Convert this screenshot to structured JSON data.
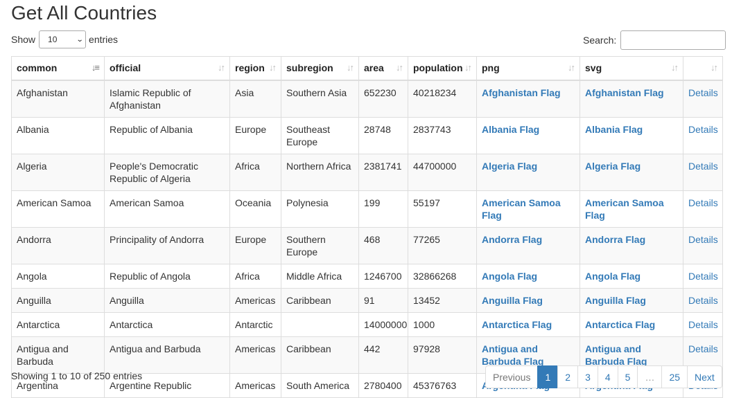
{
  "page": {
    "title": "Get All Countries"
  },
  "length": {
    "label_before": "Show",
    "value": "10",
    "label_after": "entries"
  },
  "search": {
    "label": "Search:",
    "value": ""
  },
  "table": {
    "columns": [
      "common",
      "official",
      "region",
      "subregion",
      "area",
      "population",
      "png",
      "svg",
      ""
    ],
    "rows": [
      {
        "common": "Afghanistan",
        "official": "Islamic Republic of Afghanistan",
        "region": "Asia",
        "subregion": "Southern Asia",
        "area": "652230",
        "population": "40218234",
        "png": "Afghanistan Flag",
        "svg": "Afghanistan Flag",
        "action": "Details"
      },
      {
        "common": "Albania",
        "official": "Republic of Albania",
        "region": "Europe",
        "subregion": "Southeast Europe",
        "area": "28748",
        "population": "2837743",
        "png": "Albania Flag",
        "svg": "Albania Flag",
        "action": "Details"
      },
      {
        "common": "Algeria",
        "official": "People's Democratic Republic of Algeria",
        "region": "Africa",
        "subregion": "Northern Africa",
        "area": "2381741",
        "population": "44700000",
        "png": "Algeria Flag",
        "svg": "Algeria Flag",
        "action": "Details"
      },
      {
        "common": "American Samoa",
        "official": "American Samoa",
        "region": "Oceania",
        "subregion": "Polynesia",
        "area": "199",
        "population": "55197",
        "png": "American Samoa Flag",
        "svg": "American Samoa Flag",
        "action": "Details"
      },
      {
        "common": "Andorra",
        "official": "Principality of Andorra",
        "region": "Europe",
        "subregion": "Southern Europe",
        "area": "468",
        "population": "77265",
        "png": "Andorra Flag",
        "svg": "Andorra Flag",
        "action": "Details"
      },
      {
        "common": "Angola",
        "official": "Republic of Angola",
        "region": "Africa",
        "subregion": "Middle Africa",
        "area": "1246700",
        "population": "32866268",
        "png": "Angola Flag",
        "svg": "Angola Flag",
        "action": "Details"
      },
      {
        "common": "Anguilla",
        "official": "Anguilla",
        "region": "Americas",
        "subregion": "Caribbean",
        "area": "91",
        "population": "13452",
        "png": "Anguilla Flag",
        "svg": "Anguilla Flag",
        "action": "Details"
      },
      {
        "common": "Antarctica",
        "official": "Antarctica",
        "region": "Antarctic",
        "subregion": "",
        "area": "14000000",
        "population": "1000",
        "png": "Antarctica Flag",
        "svg": "Antarctica Flag",
        "action": "Details"
      },
      {
        "common": "Antigua and Barbuda",
        "official": "Antigua and Barbuda",
        "region": "Americas",
        "subregion": "Caribbean",
        "area": "442",
        "population": "97928",
        "png": "Antigua and Barbuda Flag",
        "svg": "Antigua and Barbuda Flag",
        "action": "Details"
      },
      {
        "common": "Argentina",
        "official": "Argentine Republic",
        "region": "Americas",
        "subregion": "South America",
        "area": "2780400",
        "population": "45376763",
        "png": "Argentina Flag",
        "svg": "Argentina Flag",
        "action": "Details"
      }
    ]
  },
  "info": {
    "text": "Showing 1 to 10 of 250 entries"
  },
  "pagination": {
    "previous": "Previous",
    "pages": [
      "1",
      "2",
      "3",
      "4",
      "5",
      "…",
      "25"
    ],
    "next": "Next",
    "active": "1"
  },
  "colors": {
    "link": "#337ab7",
    "active_page_bg": "#337ab7",
    "stripe": "#f9f9f9",
    "border": "#dddddd"
  },
  "icons": {
    "sort_ascending": "sort-ascending-icon",
    "sortable": "sort-both-icon",
    "dropdown": "chevron-down-icon"
  }
}
